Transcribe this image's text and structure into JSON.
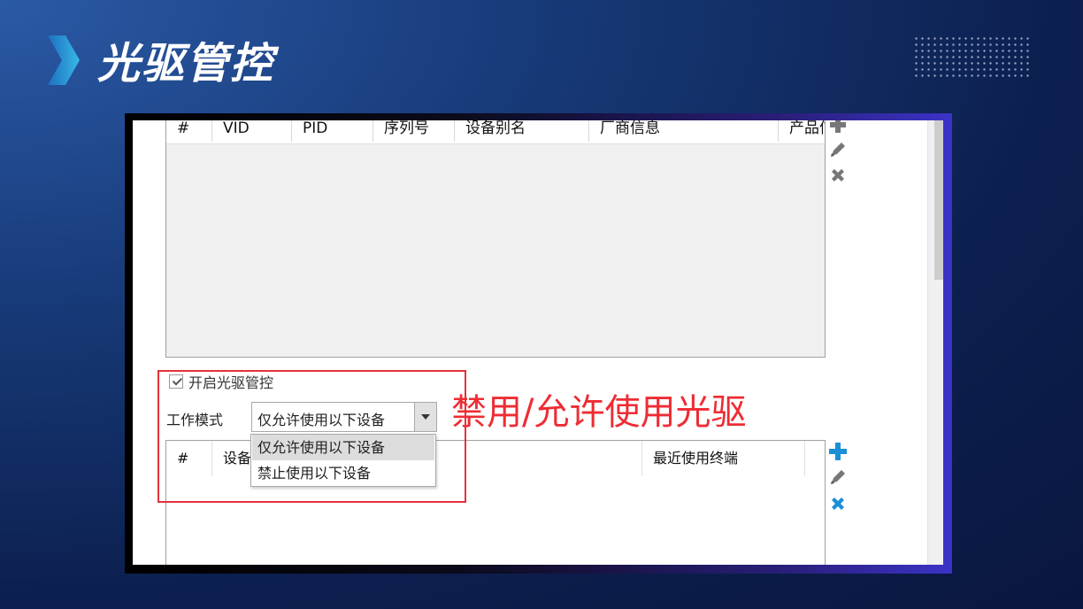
{
  "slide": {
    "title": "光驱管控"
  },
  "app": {
    "table1": {
      "columns": [
        "#",
        "VID",
        "PID",
        "序列号",
        "设备别名",
        "厂商信息",
        "产品信息"
      ]
    },
    "toolbar_top": {
      "icons": [
        "add-icon",
        "edit-icon",
        "delete-icon"
      ]
    },
    "enable_checkbox": {
      "label": "开启光驱管控",
      "checked": true
    },
    "work_mode": {
      "label": "工作模式",
      "value": "仅允许使用以下设备",
      "options": [
        "仅允许使用以下设备",
        "禁止使用以下设备"
      ]
    },
    "table2": {
      "columns": [
        "#",
        "设备",
        "最近使用终端"
      ]
    },
    "toolbar_bottom": {
      "icons": [
        "add-icon",
        "edit-icon",
        "delete-icon"
      ]
    }
  },
  "annotation": {
    "text": "禁用/允许使用光驱"
  },
  "colors": {
    "annotation_red": "#ee2c33",
    "accent_blue": "#1a8fd6",
    "background": "#0c1f4e"
  }
}
